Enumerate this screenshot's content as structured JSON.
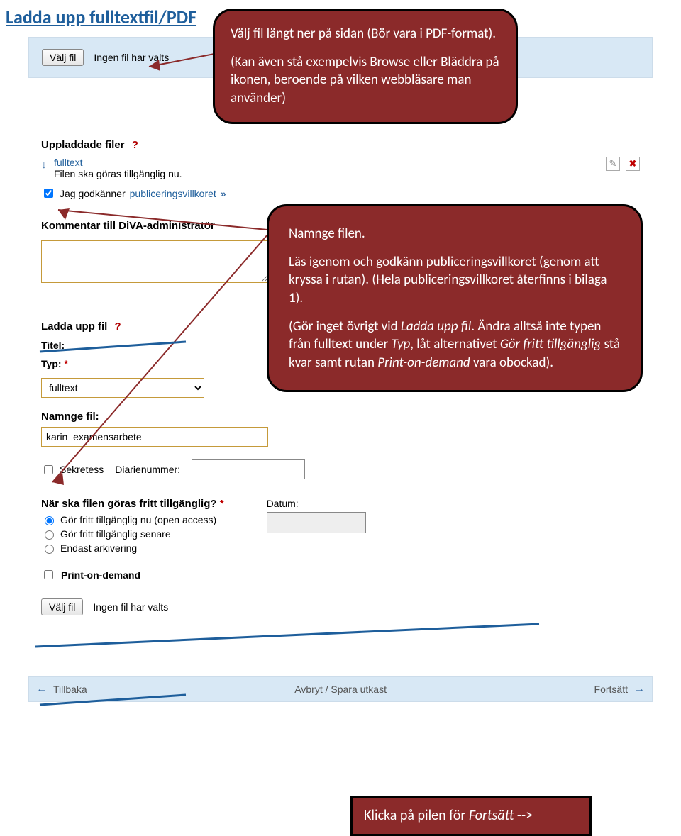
{
  "page": {
    "title": "Ladda upp fulltextfil/PDF"
  },
  "callouts": {
    "c1_p1": "Välj fil längt ner på sidan (Bör vara i PDF-format).",
    "c1_p2": "(Kan även stå exempelvis Browse eller Bläddra på ikonen, beroende på vilken webbläsare man använder)",
    "c2_p1": "Namnge filen.",
    "c2_p2": "Läs igenom och godkänn publiceringsvillkoret (genom att kryssa i rutan). (Hela publiceringsvillkoret återfinns i bilaga 1).",
    "c2_p3a": "(Gör inget övrigt  vid ",
    "c2_p3_i1": "Ladda upp fil",
    "c2_p3b": ". Ändra alltså inte typen från fulltext under ",
    "c2_p3_i2": "Typ",
    "c2_p3c": ", låt alternativet ",
    "c2_p3_i3": "Gör fritt tillgänglig",
    "c2_p3d": " stå kvar samt rutan ",
    "c2_p3_i4": "Print-on-demand",
    "c2_p3e": " vara obockad).",
    "c3_a": "Klicka på pilen för ",
    "c3_i": "Fortsätt",
    "c3_b": " -->"
  },
  "form": {
    "valj_fil_btn": "Välj fil",
    "no_file": "Ingen fil har valts",
    "uploaded_heading": "Uppladdade filer",
    "qmark": "?",
    "file_name": "fulltext",
    "file_desc": "Filen ska göras tillgänglig nu.",
    "consent_prefix": "Jag godkänner ",
    "consent_link": "publiceringsvillkoret",
    "chev": "»",
    "comment_heading": "Kommentar till DiVA-administratör",
    "ladda_upp_fil_label": "Ladda upp fil",
    "titel_label": "Titel:",
    "typ_label": "Typ:",
    "typ_value": "fulltext",
    "namnge_label": "Namnge fil:",
    "namnge_value": "karin_examensarbete",
    "sekretess_label": "Sekretess",
    "diarienr_label": "Diarienummer:",
    "when_label": "När ska filen göras fritt tillgänglig?",
    "datum_label": "Datum:",
    "radio1": "Gör fritt tillgänglig nu (open access)",
    "radio2": "Gör fritt tillgänglig senare",
    "radio3": "Endast arkivering",
    "pod_label": "Print-on-demand",
    "bottom_back": "Tillbaka",
    "bottom_mid": "Avbryt / Spara utkast",
    "bottom_next": "Fortsätt"
  }
}
